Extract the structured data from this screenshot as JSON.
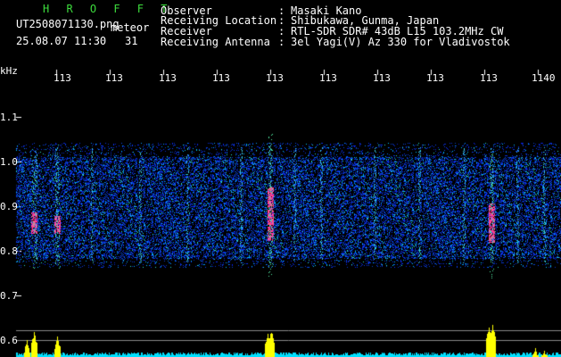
{
  "header": {
    "app_name": "H R O F F T",
    "file_name": "UT2508071130.png",
    "type_label": "meteor",
    "date_time": "25.08.07 11:30",
    "count": "31",
    "info": [
      {
        "label": "Observer",
        "sep": ":",
        "value": "Masaki Kano"
      },
      {
        "label": "Receiving Location",
        "sep": ":",
        "value": "Shibukawa, Gunma, Japan"
      },
      {
        "label": "Receiver",
        "sep": ":",
        "value": "RTL-SDR SDR# 43dB L15 103.2MHz CW"
      },
      {
        "label": "Receiving Antenna",
        "sep": ":",
        "value": "3el Yagi(V) Az 330 for Vladivostok"
      }
    ]
  },
  "axis": {
    "y_unit": "kHz",
    "y_ticks": [
      "1.1",
      "1.0",
      "0.9",
      "0.8",
      "0.7",
      "0.6"
    ],
    "x_ticks": [
      "113",
      "113",
      "113",
      "113",
      "113",
      "113",
      "113",
      "113",
      "113",
      "1140"
    ]
  },
  "colors": {
    "background": "#000000",
    "noise": "#1a2cff",
    "header_green": "#3ddc3d",
    "meteor_hot": "#ff2a6a",
    "trace_yellow": "#ffff00",
    "trace_cyan": "#00e0ff"
  }
}
